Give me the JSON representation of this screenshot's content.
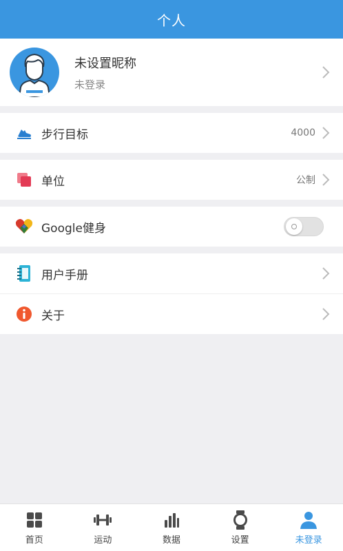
{
  "header": {
    "title": "个人"
  },
  "profile": {
    "nickname": "未设置昵称",
    "status": "未登录"
  },
  "settings": {
    "step_goal": {
      "label": "步行目标",
      "value": "4000"
    },
    "unit": {
      "label": "单位",
      "value": "公制"
    },
    "google_fit": {
      "label": "Google健身",
      "enabled": false
    },
    "manual": {
      "label": "用户手册"
    },
    "about": {
      "label": "关于"
    }
  },
  "tabs": [
    {
      "label": "首页",
      "icon": "home-grid-icon",
      "active": false
    },
    {
      "label": "运动",
      "icon": "dumbbell-icon",
      "active": false
    },
    {
      "label": "数据",
      "icon": "bar-chart-icon",
      "active": false
    },
    {
      "label": "设置",
      "icon": "watch-icon",
      "active": false
    },
    {
      "label": "未登录",
      "icon": "user-icon",
      "active": true
    }
  ],
  "colors": {
    "accent": "#3a96e0",
    "background": "#efeff2"
  }
}
